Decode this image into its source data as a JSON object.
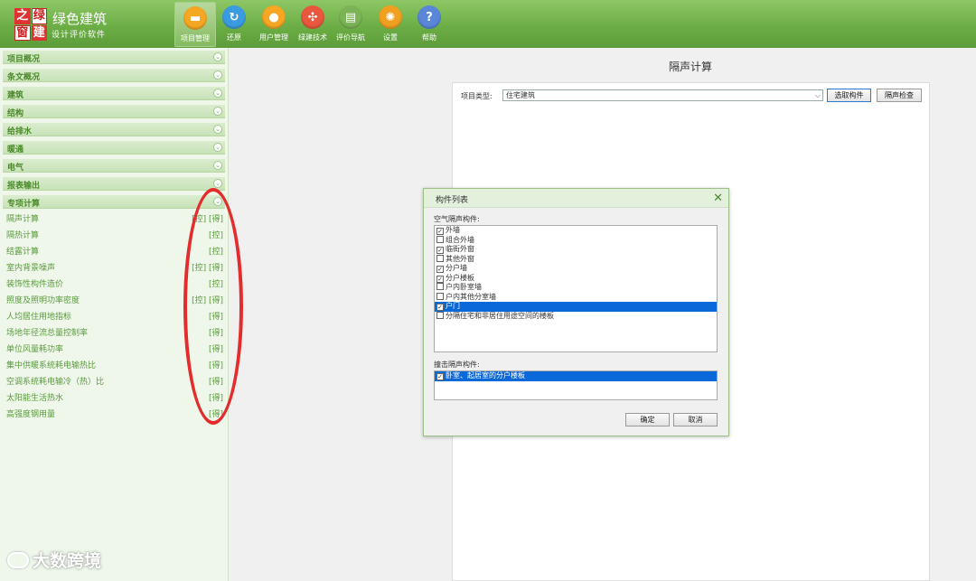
{
  "app": {
    "logo_chars": [
      "之",
      "绿",
      "窗",
      "建"
    ],
    "name": "绿色建筑",
    "subtitle": "设计评价软件"
  },
  "toolbar": [
    {
      "label": "项目管理",
      "icon": "folder-icon",
      "color": "#f5a623",
      "active": true
    },
    {
      "label": "还原",
      "icon": "refresh-icon",
      "color": "#3a9be0",
      "active": false
    },
    {
      "label": "用户管理",
      "icon": "user-icon",
      "color": "#f5a623",
      "active": false
    },
    {
      "label": "绿建技术",
      "icon": "molecule-icon",
      "color": "#e8573e",
      "active": false
    },
    {
      "label": "评价导航",
      "icon": "book-icon",
      "color": "#7bb356",
      "active": false
    },
    {
      "label": "设置",
      "icon": "gear-icon",
      "color": "#f0a020",
      "active": false
    },
    {
      "label": "帮助",
      "icon": "help-icon",
      "color": "#5a86d8",
      "active": false
    }
  ],
  "sidebar": {
    "categories": [
      "项目概况",
      "条文概况",
      "建筑",
      "结构",
      "给排水",
      "暖通",
      "电气",
      "报表输出",
      "专项计算"
    ],
    "special_items": [
      {
        "label": "隔声计算",
        "tags": "[控] [得]"
      },
      {
        "label": "隔热计算",
        "tags": "[控]"
      },
      {
        "label": "结露计算",
        "tags": "[控]"
      },
      {
        "label": "室内背景噪声",
        "tags": "[控] [得]"
      },
      {
        "label": "装饰性构件造价",
        "tags": "[控]"
      },
      {
        "label": "照度及照明功率密度",
        "tags": "[控] [得]"
      },
      {
        "label": "人均居住用地指标",
        "tags": "[得]"
      },
      {
        "label": "场地年径流总量控制率",
        "tags": "[得]"
      },
      {
        "label": "单位风量耗功率",
        "tags": "[得]"
      },
      {
        "label": "集中供暖系统耗电输热比",
        "tags": "[得]"
      },
      {
        "label": "空调系统耗电输冷（热）比",
        "tags": "[得]"
      },
      {
        "label": "太阳能生活热水",
        "tags": "[得]"
      },
      {
        "label": "高强度钢用量",
        "tags": "[得]"
      }
    ]
  },
  "watermark": "大数跨境",
  "main": {
    "title": "隔声计算",
    "project_type_label": "项目类型:",
    "project_type_value": "住宅建筑",
    "select_button": "选取构件",
    "check_button": "隔声检查"
  },
  "dialog": {
    "title": "构件列表",
    "air_label": "空气隔声构件:",
    "air_items": [
      {
        "label": "外墙",
        "checked": true,
        "selected": false
      },
      {
        "label": "组合外墙",
        "checked": false,
        "selected": false
      },
      {
        "label": "临街外窗",
        "checked": true,
        "selected": false
      },
      {
        "label": "其他外窗",
        "checked": false,
        "selected": false
      },
      {
        "label": "分户墙",
        "checked": true,
        "selected": false
      },
      {
        "label": "分户楼板",
        "checked": true,
        "selected": false
      },
      {
        "label": "户内卧室墙",
        "checked": false,
        "selected": false
      },
      {
        "label": "户内其他分室墙",
        "checked": false,
        "selected": false
      },
      {
        "label": "户门",
        "checked": true,
        "selected": true
      },
      {
        "label": "分隔住宅和非居住用途空间的楼板",
        "checked": false,
        "selected": false
      }
    ],
    "impact_label": "撞击隔声构件:",
    "impact_items": [
      {
        "label": "卧室、起居室的分户楼板",
        "checked": true,
        "selected": true
      }
    ],
    "ok": "确定",
    "cancel": "取消"
  }
}
